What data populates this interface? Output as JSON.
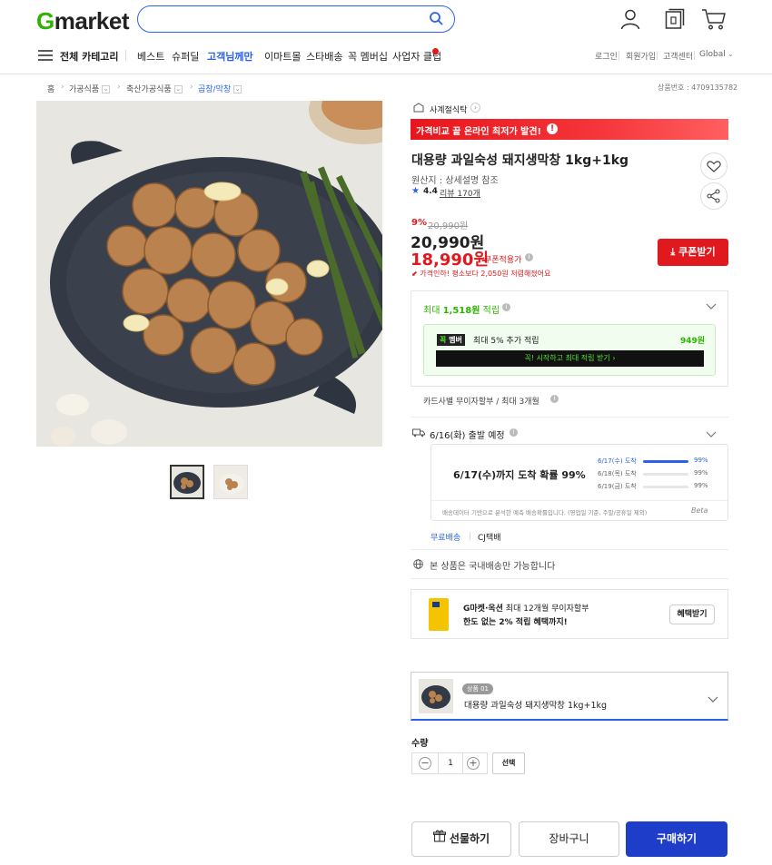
{
  "header": {
    "logo_g": "G",
    "logo_rest": "market",
    "search_placeholder": "",
    "icons": [
      "user-icon",
      "recent-items-icon",
      "cart-icon"
    ]
  },
  "nav": {
    "all_categories": "전체 카테고리",
    "items": [
      "베스트",
      "슈퍼딜",
      "고객님께만",
      "이마트몰",
      "스타배송",
      "꼭 멤버십",
      "사업자 클럽"
    ],
    "highlight_index": 2,
    "utility": [
      "로그인",
      "회원가입",
      "고객센터",
      "Global"
    ]
  },
  "breadcrumb": {
    "items": [
      "홈",
      "가공식품",
      "축산가공식품",
      "곱창/막창"
    ],
    "product_number": "상품번호 : 4709135782"
  },
  "product": {
    "seller": "사계절식탁",
    "price_banner": "가격비교 끝 온라인 최저가 발견!",
    "title": "대용량 과일숙성 돼지생막창 1kg+1kg",
    "origin": "원산지 : 상세설명 참조",
    "rating": "4.4",
    "review": "리뷰 170개",
    "discount_rate": "9%",
    "original_price": "20,990원",
    "sale_price": "20,990원",
    "coupon_price": "18,990원",
    "coupon_label": "쿠폰적용가",
    "price_note": "가격인하! 평소보다 2,050원 저렴해졌어요",
    "coupon_button": "쿠폰받기"
  },
  "points": {
    "max_points_prefix": "최대 ",
    "max_points_value": "1,518원",
    "max_points_suffix": " 적립",
    "member_badge_a": "꼭",
    "member_badge_b": "멤버",
    "member_text": "최대 5% 추가 적립",
    "member_value": "949원",
    "member_cta": "꼭! 시작하고 최대 적립 받기 ›",
    "installment": "카드사별 무이자할부 / 최대 3개월"
  },
  "delivery": {
    "ship_date": "6/16(화) 출발 예정",
    "headline": "6/17(수)까지 도착 확률 99%",
    "rows": [
      {
        "date": "6/17(수) 도착",
        "pct": "99%",
        "fill": 0.99
      },
      {
        "date": "6/18(목) 도착",
        "pct": "99%",
        "fill": 0.0
      },
      {
        "date": "6/19(금) 도착",
        "pct": "99%",
        "fill": 0.0
      }
    ],
    "note": "배송데이터 기반으로 분석한 예측 배송확률입니다. (영업일 기준, 주말/공휴일 제외)",
    "beta": "Beta",
    "free_shipping": "무료배송",
    "courier": "CJ택배",
    "domestic_only": "본 상품은 국내배송만 가능합니다"
  },
  "card_promo": {
    "line1_bold": "G마켓·옥션",
    "line1_rest": " 최대 12개월 무이자할부",
    "line2": "한도 없는 2% 적립 혜택까지!",
    "button": "혜택받기"
  },
  "option": {
    "badge": "상품 01",
    "name": "대용량 과일숙성 돼지생막창 1kg+1kg"
  },
  "quantity": {
    "label": "수량",
    "value": "1",
    "select": "선택"
  },
  "actions": {
    "gift": "선물하기",
    "cart": "장바구니",
    "buy": "구매하기"
  },
  "colors": {
    "brand_green": "#2db400",
    "accent_blue": "#2b63e6",
    "sale_red": "#e0191e",
    "buy_blue": "#1e3ec9"
  }
}
